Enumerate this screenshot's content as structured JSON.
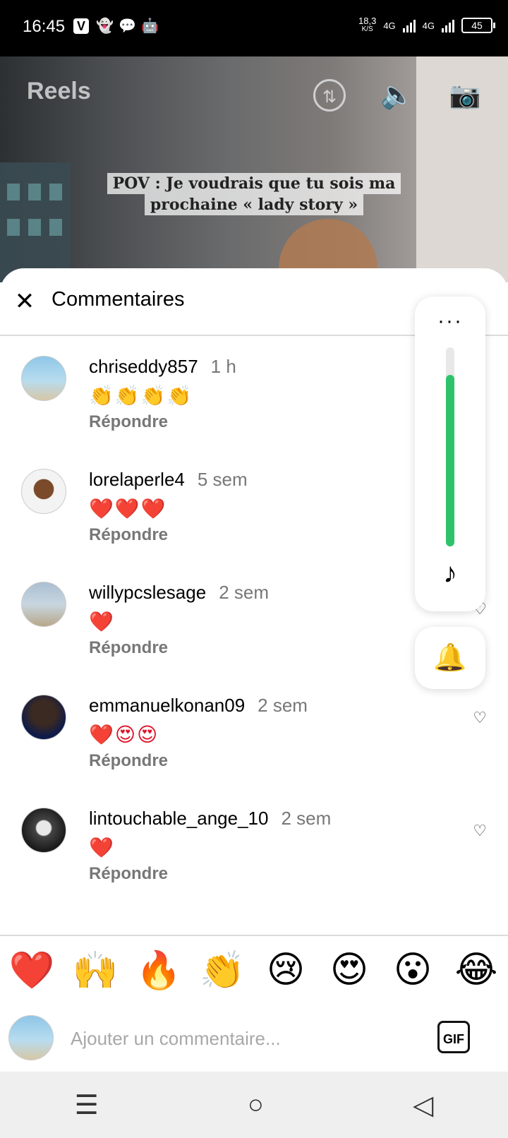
{
  "status": {
    "time": "16:45",
    "speed_value": "18,3",
    "speed_unit": "K/S",
    "network1": "4G",
    "network2": "4G",
    "battery": "45",
    "app_icons": [
      "v-app-icon",
      "snapchat-icon",
      "message-icon",
      "android-icon"
    ]
  },
  "reel": {
    "title": "Reels",
    "caption_line1": "POV : Je voudrais que tu sois ma",
    "caption_line2": "prochaine « lady story »"
  },
  "sheet": {
    "title": "Commentaires"
  },
  "comments": [
    {
      "user": "chriseddy857",
      "time": "1 h",
      "text": "👏👏👏👏",
      "reply": "Répondre"
    },
    {
      "user": "lorelaperle4",
      "time": "5 sem",
      "text": "❤️❤️❤️",
      "reply": "Répondre"
    },
    {
      "user": "willypcslesage",
      "time": "2 sem",
      "text": "❤️",
      "reply": "Répondre"
    },
    {
      "user": "emmanuelkonan09",
      "time": "2 sem",
      "text": "❤️😍😍",
      "reply": "Répondre"
    },
    {
      "user": "lintouchable_ange_10",
      "time": "2 sem",
      "text": "❤️",
      "reply": "Répondre"
    }
  ],
  "volume": {
    "level": 0.86,
    "accent": "#2ec36b"
  },
  "quick_emojis": [
    "❤️",
    "🙌",
    "🔥",
    "👏",
    "😢",
    "😍",
    "😮",
    "😂"
  ],
  "composer": {
    "placeholder": "Ajouter un commentaire...",
    "gif_label": "GIF"
  }
}
